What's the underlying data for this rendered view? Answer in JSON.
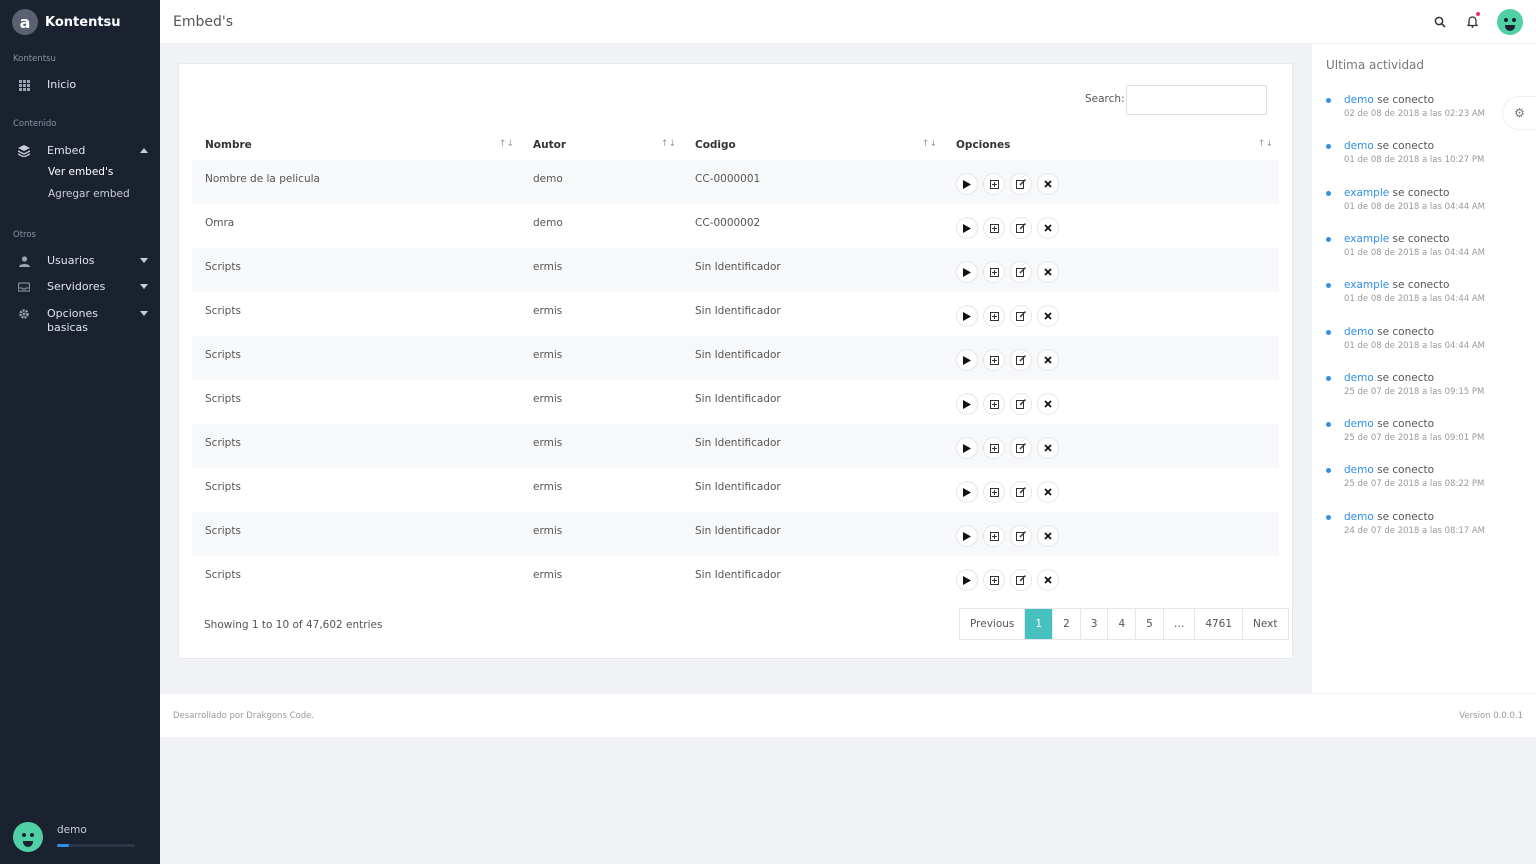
{
  "brand": {
    "logo_letter": "a",
    "name": "Kontentsu"
  },
  "sidebar": {
    "sections": [
      {
        "label": "Kontentsu"
      },
      {
        "label": "Contenido"
      },
      {
        "label": "Otros"
      }
    ],
    "items": {
      "inicio": "Inicio",
      "embed": "Embed",
      "ver_embeds": "Ver embed's",
      "agregar_embed": "Agregar embed",
      "usuarios": "Usuarios",
      "servidores": "Servidores",
      "opciones_basicas": "Opciones basicas"
    },
    "user": {
      "name": "demo",
      "progress": 0.15
    }
  },
  "header": {
    "title": "Embed's"
  },
  "main": {
    "search_label": "Search:",
    "search_value": "",
    "columns": [
      "Nombre",
      "Autor",
      "Codigo",
      "Opciones"
    ],
    "rows": [
      {
        "nombre": "Nombre de la pelicula",
        "autor": "demo",
        "codigo": "CC-0000001"
      },
      {
        "nombre": "Omra",
        "autor": "demo",
        "codigo": "CC-0000002"
      },
      {
        "nombre": "Scripts",
        "autor": "ermis",
        "codigo": "Sin Identificador"
      },
      {
        "nombre": "Scripts",
        "autor": "ermis",
        "codigo": "Sin Identificador"
      },
      {
        "nombre": "Scripts",
        "autor": "ermis",
        "codigo": "Sin Identificador"
      },
      {
        "nombre": "Scripts",
        "autor": "ermis",
        "codigo": "Sin Identificador"
      },
      {
        "nombre": "Scripts",
        "autor": "ermis",
        "codigo": "Sin Identificador"
      },
      {
        "nombre": "Scripts",
        "autor": "ermis",
        "codigo": "Sin Identificador"
      },
      {
        "nombre": "Scripts",
        "autor": "ermis",
        "codigo": "Sin Identificador"
      },
      {
        "nombre": "Scripts",
        "autor": "ermis",
        "codigo": "Sin Identificador"
      }
    ],
    "entries_info": "Showing 1 to 10 of 47,602 entries",
    "pagination": [
      "Previous",
      "1",
      "2",
      "3",
      "4",
      "5",
      "…",
      "4761",
      "Next"
    ],
    "active_page": "1"
  },
  "activity": {
    "title": "Ultima actividad",
    "items": [
      {
        "user": "demo",
        "action": "se conecto",
        "time": "02 de 08 de 2018 a las 02:23 AM"
      },
      {
        "user": "demo",
        "action": "se conecto",
        "time": "01 de 08 de 2018 a las 10:27 PM"
      },
      {
        "user": "example",
        "action": "se conecto",
        "time": "01 de 08 de 2018 a las 04:44 AM"
      },
      {
        "user": "example",
        "action": "se conecto",
        "time": "01 de 08 de 2018 a las 04:44 AM"
      },
      {
        "user": "example",
        "action": "se conecto",
        "time": "01 de 08 de 2018 a las 04:44 AM"
      },
      {
        "user": "demo",
        "action": "se conecto",
        "time": "01 de 08 de 2018 a las 04:44 AM"
      },
      {
        "user": "demo",
        "action": "se conecto",
        "time": "25 de 07 de 2018 a las 09:15 PM"
      },
      {
        "user": "demo",
        "action": "se conecto",
        "time": "25 de 07 de 2018 a las 09:01 PM"
      },
      {
        "user": "demo",
        "action": "se conecto",
        "time": "25 de 07 de 2018 a las 08:22 PM"
      },
      {
        "user": "demo",
        "action": "se conecto",
        "time": "24 de 07 de 2018 a las 08:17 AM"
      }
    ]
  },
  "footer": {
    "left": "Desarrollado por Drakgons Code.",
    "right": "Version 0.0.0.1"
  },
  "colors": {
    "sidebar_bg": "#1a2230",
    "accent": "#47c1bf",
    "link": "#2f8ee5",
    "notification": "#e6396a"
  },
  "icons": {
    "inicio": "grid-icon",
    "embed": "layers-icon",
    "usuarios": "user-icon",
    "servidores": "inbox-icon",
    "opciones": "gear-icon",
    "row_actions": [
      "play-icon",
      "plus-square-icon",
      "edit-icon",
      "close-icon"
    ]
  }
}
